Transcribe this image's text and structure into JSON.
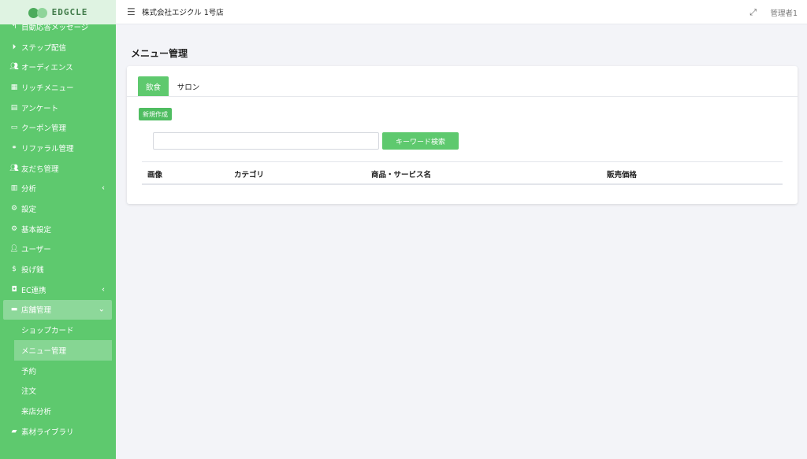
{
  "brand": {
    "logo_text": "EDGCLE"
  },
  "sidebar": {
    "items": [
      {
        "label": "自動応答メッセージ",
        "icon": "reply-icon"
      },
      {
        "label": "ステップ配信",
        "icon": "play-circle-icon"
      },
      {
        "label": "オーディエンス",
        "icon": "users-icon"
      },
      {
        "label": "リッチメニュー",
        "icon": "grid-icon"
      },
      {
        "label": "アンケート",
        "icon": "poll-icon"
      },
      {
        "label": "クーポン管理",
        "icon": "ticket-icon"
      },
      {
        "label": "リファラル管理",
        "icon": "link-icon"
      },
      {
        "label": "友だち管理",
        "icon": "friends-icon"
      },
      {
        "label": "分析",
        "icon": "chart-icon"
      },
      {
        "label": "設定",
        "icon": "gear-icon"
      },
      {
        "label": "基本設定",
        "icon": "gear-icon"
      },
      {
        "label": "ユーザー",
        "icon": "user-icon"
      },
      {
        "label": "投げ銭",
        "icon": "dollar-icon"
      },
      {
        "label": "EC連携",
        "icon": "bag-icon"
      },
      {
        "label": "店舗管理",
        "icon": "store-icon"
      },
      {
        "label": "ショップカード"
      },
      {
        "label": "メニュー管理"
      },
      {
        "label": "予約"
      },
      {
        "label": "注文"
      },
      {
        "label": "来店分析"
      },
      {
        "label": "素材ライブラリ",
        "icon": "folder-icon"
      }
    ]
  },
  "header": {
    "store_name": "株式会社エジクル 1号店",
    "admin": "管理者1"
  },
  "main": {
    "title": "メニュー管理",
    "tabs": [
      {
        "label": "飲食"
      },
      {
        "label": "サロン"
      }
    ],
    "new_button": "新規作成",
    "search": {
      "value": "",
      "button": "キーワード検索"
    },
    "table": {
      "columns": [
        "画像",
        "カテゴリ",
        "商品・サービス名",
        "販売価格"
      ]
    }
  },
  "colors": {
    "accent": "#5ec96e",
    "sidebar_bg": "#5ec96e",
    "page_bg": "#f3f4f8"
  }
}
